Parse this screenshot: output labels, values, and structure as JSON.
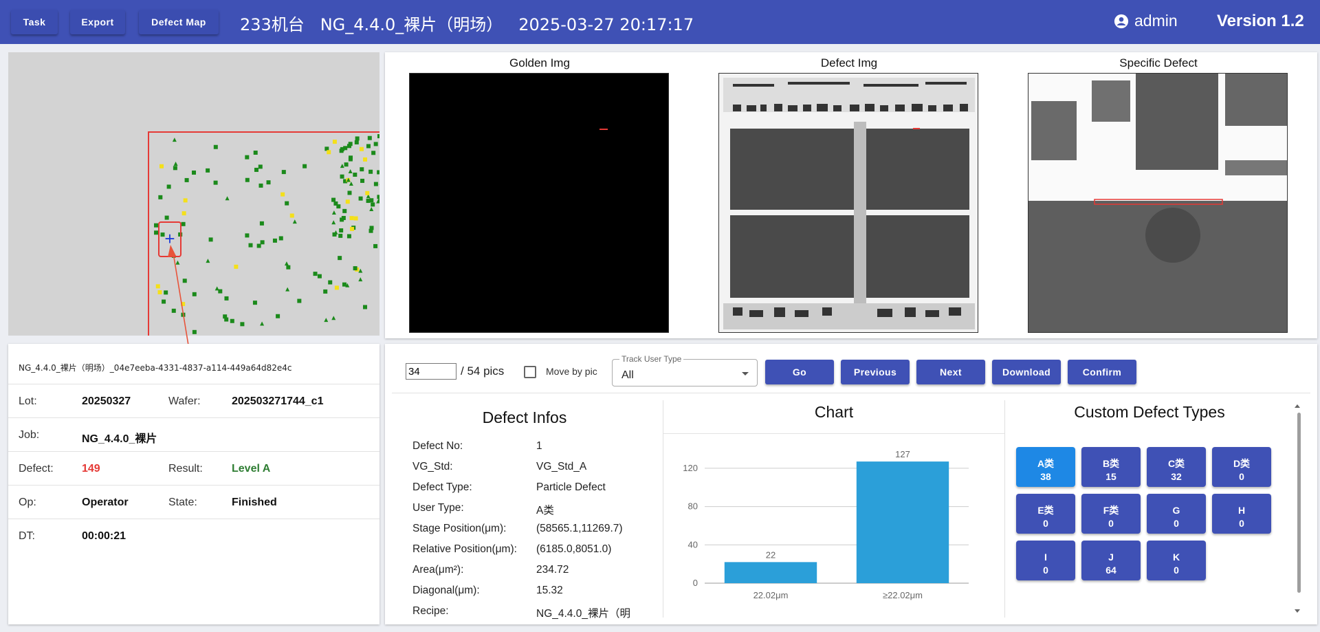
{
  "topbar": {
    "task_label": "Task",
    "export_label": "Export",
    "defect_map_label": "Defect Map",
    "title": "233机台   NG_4.4.0_裸片（明场）   2025-03-27 20:17:17",
    "user": "admin",
    "version": "Version 1.2",
    "bg_color": "#3f51b5"
  },
  "info": {
    "uuid": "NG_4.4.0_裸片（明场）_04e7eeba-4331-4837-a114-449a64d82e4c",
    "lot_label": "Lot:",
    "lot": "20250327",
    "wafer_label": "Wafer:",
    "wafer": "202503271744_c1",
    "job_label": "Job:",
    "job": "NG_4.4.0_裸片",
    "defect_label": "Defect:",
    "defect": "149",
    "result_label": "Result:",
    "result": "Level A",
    "op_label": "Op:",
    "op": "Operator",
    "state_label": "State:",
    "state": "Finished",
    "dt_label": "DT:",
    "dt": "00:00:21",
    "defect_color": "#e53935",
    "result_color": "#2e7d32"
  },
  "images": {
    "golden_title": "Golden Img",
    "defect_title": "Defect Img",
    "specific_title": "Specific Defect"
  },
  "control": {
    "pic_value": "34",
    "pic_total": "/ 54 pics",
    "move_by_pic_label": "Move by pic",
    "track_label": "Track User Type",
    "track_value": "All",
    "go_label": "Go",
    "prev_label": "Previous",
    "next_label": "Next",
    "download_label": "Download",
    "confirm_label": "Confirm"
  },
  "defect_infos": {
    "title": "Defect Infos",
    "rows": [
      {
        "label": "Defect No:",
        "value": "1"
      },
      {
        "label": "VG_Std:",
        "value": "VG_Std_A"
      },
      {
        "label": "Defect Type:",
        "value": "Particle Defect"
      },
      {
        "label": "User Type:",
        "value": "A类"
      },
      {
        "label": "Stage Position(μm):",
        "value": "(58565.1,11269.7)"
      },
      {
        "label": "Relative Position(μm):",
        "value": "(6185.0,8051.0)"
      },
      {
        "label": "Area(μm²):",
        "value": "234.72"
      },
      {
        "label": "Diagonal(μm):",
        "value": "15.32"
      },
      {
        "label": "Recipe:",
        "value": "NG_4.4.0_裸片（明"
      }
    ]
  },
  "chart_data": {
    "type": "bar",
    "title": "Chart",
    "categories": [
      "22.02μm",
      "≥22.02μm"
    ],
    "values": [
      22,
      127
    ],
    "ylim": [
      0,
      140
    ],
    "yticks": [
      "0",
      "40",
      "80",
      "120"
    ],
    "bar_color": "#2b9fd9",
    "grid": true
  },
  "custom_types": {
    "title": "Custom Defect Types",
    "items": [
      {
        "name": "A类",
        "count": "38",
        "active": true
      },
      {
        "name": "B类",
        "count": "15"
      },
      {
        "name": "C类",
        "count": "32"
      },
      {
        "name": "D类",
        "count": "0"
      },
      {
        "name": "E类",
        "count": "0"
      },
      {
        "name": "F类",
        "count": "0"
      },
      {
        "name": "G",
        "count": "0"
      },
      {
        "name": "H",
        "count": "0"
      },
      {
        "name": "I",
        "count": "0"
      },
      {
        "name": "J",
        "count": "64"
      },
      {
        "name": "K",
        "count": "0"
      }
    ]
  }
}
